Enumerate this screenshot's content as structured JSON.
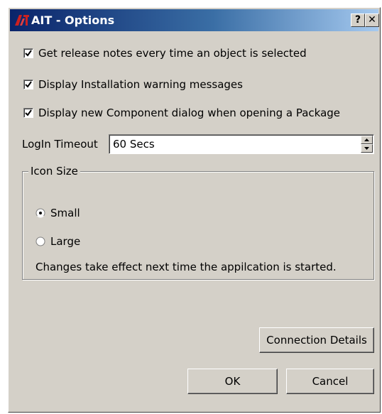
{
  "window": {
    "title": "AIT - Options",
    "help_button": "?",
    "close_button": "✕"
  },
  "options": {
    "release_notes": {
      "label": "Get release notes every time an object is selected",
      "checked": true
    },
    "install_warnings": {
      "label": "Display Installation warning messages",
      "checked": true
    },
    "new_component": {
      "label": "Display new Component dialog when opening a Package",
      "checked": true
    }
  },
  "login_timeout": {
    "label": "LogIn Timeout",
    "value": "60 Secs"
  },
  "icon_size": {
    "legend": "Icon Size",
    "small_label": "Small",
    "large_label": "Large",
    "selected": "Small",
    "note": "Changes take effect next time the appilcation is started."
  },
  "buttons": {
    "connection_details": "Connection Details",
    "ok": "OK",
    "cancel": "Cancel"
  },
  "colors": {
    "dialog_face": "#d4d0c8",
    "titlebar_start": "#0a246a",
    "titlebar_end": "#a6caf0",
    "logo_red": "#cc2020"
  }
}
